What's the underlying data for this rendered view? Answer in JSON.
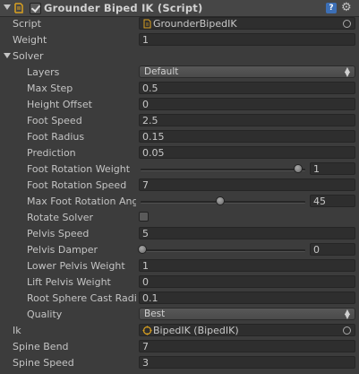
{
  "component": {
    "title": "Grounder Biped IK (Script)",
    "help_label": "?",
    "gear_icon": "gear-icon",
    "enabled": true
  },
  "fields": {
    "script": {
      "label": "Script",
      "value": "GrounderBipedIK"
    },
    "weight": {
      "label": "Weight",
      "value": "1"
    },
    "solver": {
      "label": "Solver"
    },
    "layers": {
      "label": "Layers",
      "value": "Default"
    },
    "max_step": {
      "label": "Max Step",
      "value": "0.5"
    },
    "height_offset": {
      "label": "Height Offset",
      "value": "0"
    },
    "foot_speed": {
      "label": "Foot Speed",
      "value": "2.5"
    },
    "foot_radius": {
      "label": "Foot Radius",
      "value": "0.15"
    },
    "prediction": {
      "label": "Prediction",
      "value": "0.05"
    },
    "foot_rotation_weight": {
      "label": "Foot Rotation Weight",
      "value": "1",
      "fraction": 1.0
    },
    "foot_rotation_speed": {
      "label": "Foot Rotation Speed",
      "value": "7"
    },
    "max_foot_rotation_angle": {
      "label": "Max Foot Rotation Angle",
      "value": "45",
      "fraction": 0.5
    },
    "rotate_solver": {
      "label": "Rotate Solver",
      "checked": false
    },
    "pelvis_speed": {
      "label": "Pelvis Speed",
      "value": "5"
    },
    "pelvis_damper": {
      "label": "Pelvis Damper",
      "value": "0",
      "fraction": 0.0
    },
    "lower_pelvis_weight": {
      "label": "Lower Pelvis Weight",
      "value": "1"
    },
    "lift_pelvis_weight": {
      "label": "Lift Pelvis Weight",
      "value": "0"
    },
    "root_sphere_cast_radius": {
      "label": "Root Sphere Cast Radius",
      "value": "0.1"
    },
    "quality": {
      "label": "Quality",
      "value": "Best"
    },
    "ik": {
      "label": "Ik",
      "value": "BipedIK (BipedIK)"
    },
    "spine_bend": {
      "label": "Spine Bend",
      "value": "7"
    },
    "spine_speed": {
      "label": "Spine Speed",
      "value": "3"
    }
  },
  "colors": {
    "background": "#3c3c3c",
    "header": "#464646",
    "field_bg": "#2e2e2e",
    "text": "#c4c4c4",
    "help_blue": "#3c6fb6",
    "script_icon_orange": "#d9a020"
  }
}
